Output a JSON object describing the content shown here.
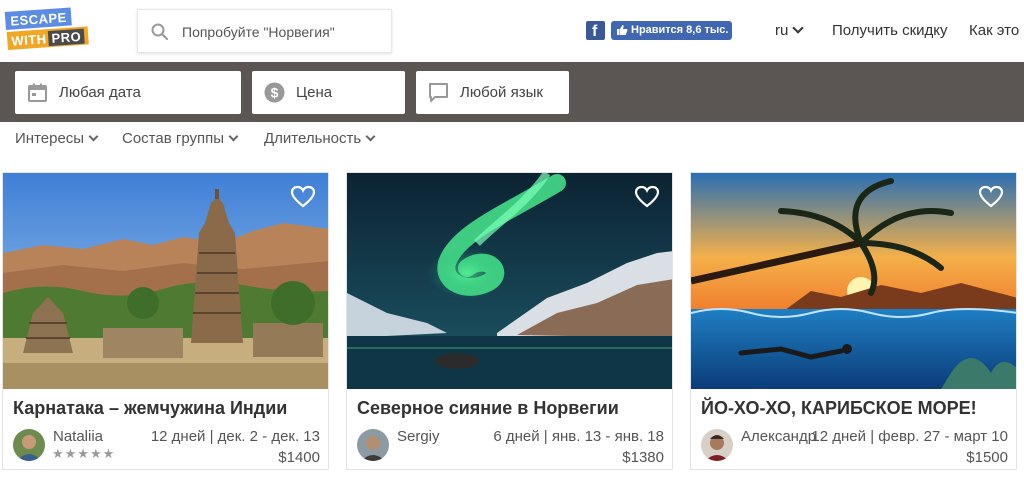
{
  "header": {
    "logo": {
      "line1": "ESCAPE",
      "line2": "WITH",
      "line3": "PRO"
    },
    "search": {
      "placeholder": "Попробуйте \"Норвегия\""
    },
    "facebook": {
      "like_label": "Нравится 8,6 тыс."
    },
    "language": "ru",
    "nav": {
      "discount": "Получить скидку",
      "how": "Как это р"
    }
  },
  "filters": {
    "date": "Любая дата",
    "price": "Цена",
    "language": "Любой язык"
  },
  "subfilters": {
    "interests": "Интересы",
    "group": "Состав группы",
    "duration": "Длительность"
  },
  "cards": [
    {
      "title": "Карнатака – жемчужина Индии",
      "guide": "Nataliia",
      "rating": 5,
      "stars": "★★★★★",
      "meta": "12 дней | дек. 2 - дек. 13",
      "price": "$1400"
    },
    {
      "title": "Северное сияние в Норвегии",
      "guide": "Sergiy",
      "meta": "6 дней | янв. 13 - янв. 18",
      "price": "$1380"
    },
    {
      "title": "ЙО-ХО-ХО, КАРИБСКОЕ МОРЕ!",
      "guide": "Александр",
      "meta": "12 дней | февр. 27 - март 10",
      "price": "$1500"
    }
  ],
  "colors": {
    "filterbar": "#5b5654",
    "facebook": "#3b5998",
    "logo_blue": "#5d8de3",
    "logo_orange": "#f0a626"
  },
  "icons": [
    "search-icon",
    "facebook-icon",
    "thumbs-up-icon",
    "chevron-down-icon",
    "calendar-icon",
    "dollar-icon",
    "speech-bubble-icon",
    "heart-icon"
  ]
}
